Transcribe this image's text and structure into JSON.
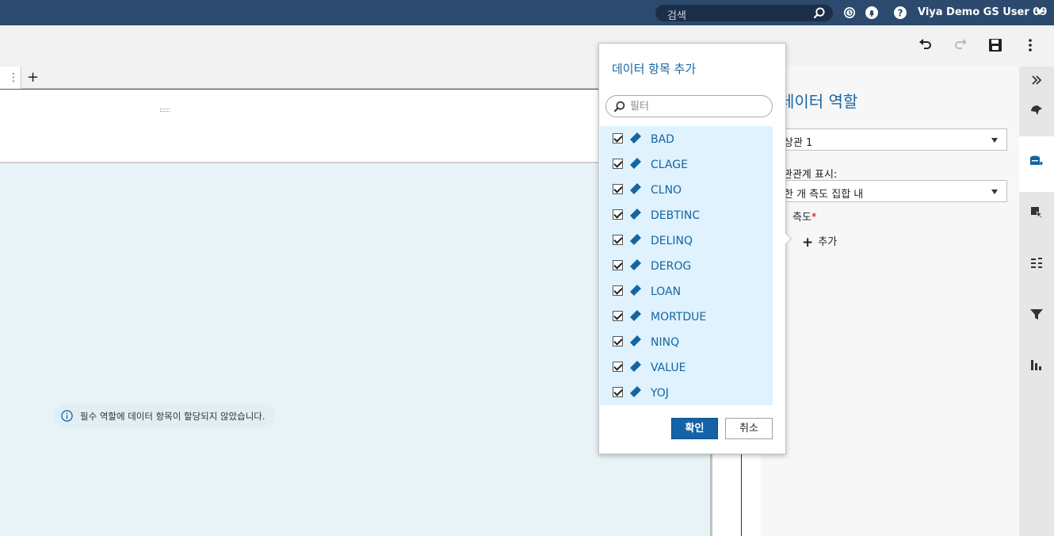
{
  "header": {
    "search_placeholder": "검색",
    "user_name": "Viya Demo GS User 09",
    "icons": [
      "search-icon",
      "history-icon",
      "bell-icon",
      "help-icon",
      "caret-down-icon"
    ]
  },
  "toolbar": {
    "icons": [
      "undo-icon",
      "redo-icon",
      "save-icon",
      "more-vert-icon"
    ]
  },
  "tabs": {
    "add_label": "+"
  },
  "canvas": {
    "info_message": "필수 역할에 데이터 항목이 할당되지 않았습니다."
  },
  "roles_pane": {
    "title": "데이터 역할",
    "object_select": "상관 1",
    "show_correlation_label": "관관계 표시:",
    "show_correlation_value": "한 개 측도 집합 내",
    "measures_label": "측도",
    "required_marker": "*",
    "add_label": "추가"
  },
  "right_rail": {
    "icons": [
      "collapse-icon",
      "options-icon",
      "data-roles-icon",
      "actions-icon",
      "rules-icon",
      "filter-icon",
      "ranks-icon"
    ]
  },
  "popup": {
    "title": "데이터 항목 추가",
    "filter_placeholder": "필터",
    "items": [
      {
        "label": "BAD",
        "checked": true
      },
      {
        "label": "CLAGE",
        "checked": true
      },
      {
        "label": "CLNO",
        "checked": true
      },
      {
        "label": "DEBTINC",
        "checked": true
      },
      {
        "label": "DELINQ",
        "checked": true
      },
      {
        "label": "DEROG",
        "checked": true
      },
      {
        "label": "LOAN",
        "checked": true
      },
      {
        "label": "MORTDUE",
        "checked": true
      },
      {
        "label": "NINQ",
        "checked": true
      },
      {
        "label": "VALUE",
        "checked": true
      },
      {
        "label": "YOJ",
        "checked": true
      }
    ],
    "ok_label": "확인",
    "cancel_label": "취소"
  },
  "colors": {
    "topbar": "#2b4a6e",
    "accent": "#1565a3",
    "list_highlight": "#dff2fd",
    "canvas_bg": "#e8f3f7"
  }
}
